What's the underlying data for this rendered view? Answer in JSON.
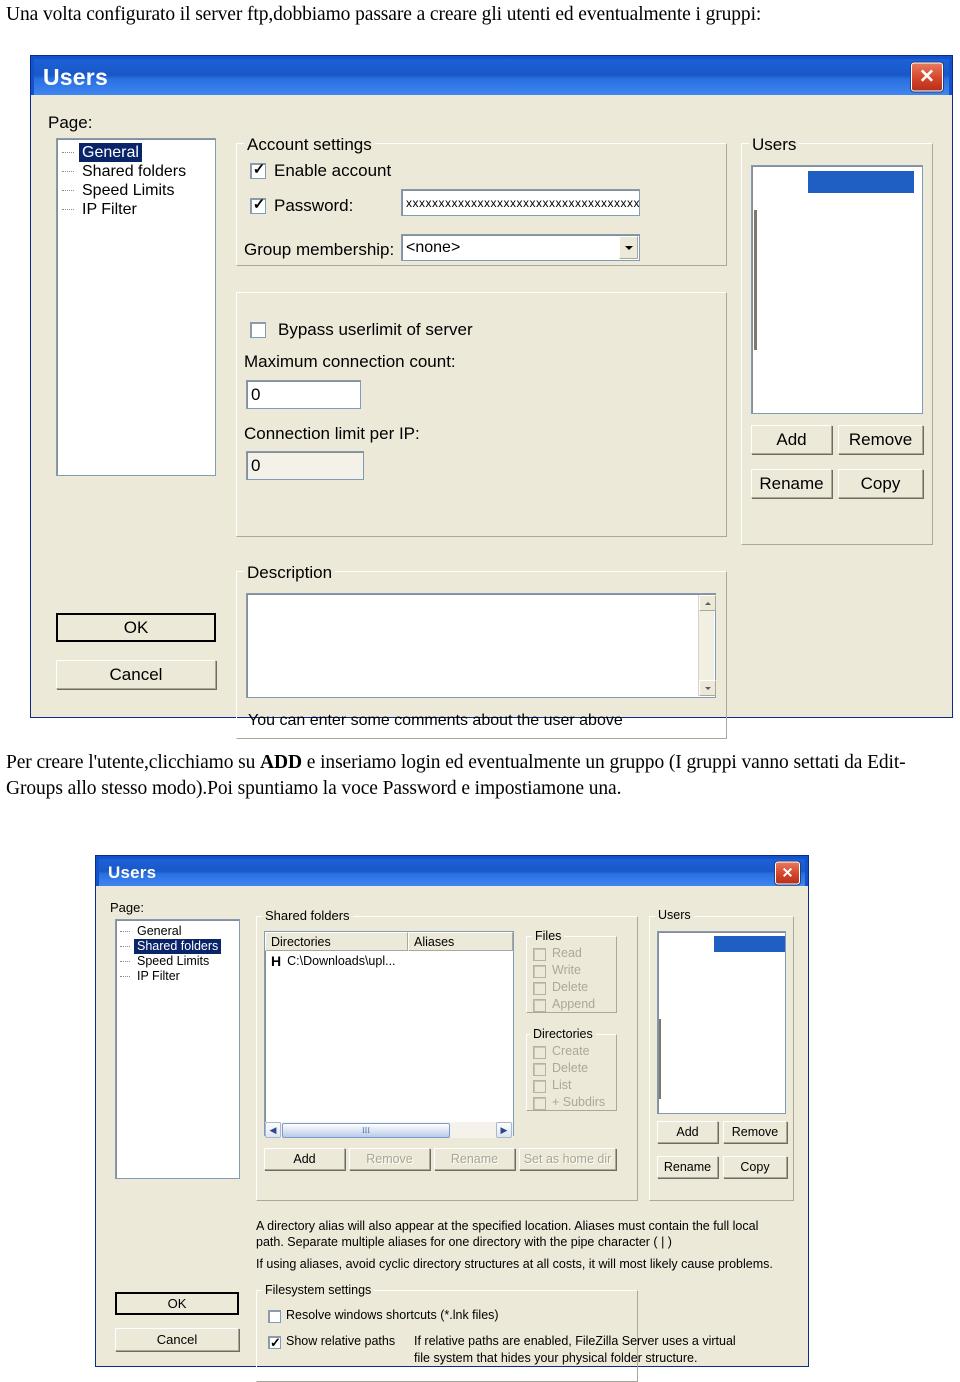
{
  "document": {
    "intro_paragraph": "Una volta configurato il server ftp,dobbiamo passare a creare gli utenti ed eventualmente i gruppi:",
    "middle_paragraph_part1": "Per creare l'utente,clicchiamo su ",
    "middle_paragraph_bold": "ADD",
    "middle_paragraph_part2": " e inseriamo login ed eventualmente un gruppo (I gruppi vanno settati da Edit-Groups  allo stesso modo).Poi spuntiamo la voce Password e impostiamone una."
  },
  "colors": {
    "titlebar_blue": "#1a58c8",
    "dialog_face": "#ece9d8",
    "selection_blue": "#0a246a",
    "list_selection": "#1f5fc4",
    "close_red": "#d5452a",
    "disabled_text": "#a9a48f"
  },
  "dialog1": {
    "title": "Users",
    "close_label": "✕",
    "page_label": "Page:",
    "tree": {
      "items": [
        {
          "label": "General",
          "selected": true
        },
        {
          "label": "Shared folders",
          "selected": false
        },
        {
          "label": "Speed Limits",
          "selected": false
        },
        {
          "label": "IP Filter",
          "selected": false
        }
      ]
    },
    "account_settings": {
      "group_title": "Account settings",
      "enable_account": {
        "label": "Enable account",
        "checked": true
      },
      "password": {
        "label": "Password:",
        "checked": true,
        "value": "xxxxxxxxxxxxxxxxxxxxxxxxxxxxxxxxxxxx"
      },
      "group_membership": {
        "label": "Group membership:",
        "value": "<none>"
      }
    },
    "limits": {
      "bypass_userlimit": {
        "label": "Bypass userlimit of server",
        "checked": false
      },
      "max_connection_count": {
        "label": "Maximum connection count:",
        "value": "0"
      },
      "connection_limit_per_ip": {
        "label": "Connection limit per IP:",
        "value": "0"
      }
    },
    "description": {
      "group_title": "Description",
      "value": "",
      "hint": "You can enter some comments about the user above"
    },
    "users_panel": {
      "group_title": "Users",
      "buttons": [
        "Add",
        "Remove",
        "Rename",
        "Copy"
      ]
    },
    "ok_label": "OK",
    "cancel_label": "Cancel"
  },
  "dialog2": {
    "title": "Users",
    "close_label": "✕",
    "page_label": "Page:",
    "tree": {
      "items": [
        {
          "label": "General",
          "selected": false
        },
        {
          "label": "Shared folders",
          "selected": true
        },
        {
          "label": "Speed Limits",
          "selected": false
        },
        {
          "label": "IP Filter",
          "selected": false
        }
      ]
    },
    "shared_folders": {
      "group_title": "Shared folders",
      "columns": [
        "Directories",
        "Aliases"
      ],
      "rows": [
        {
          "flag": "H",
          "directory": "C:\\Downloads\\upl...",
          "alias": ""
        }
      ],
      "buttons": [
        {
          "label": "Add",
          "disabled": false
        },
        {
          "label": "Remove",
          "disabled": true
        },
        {
          "label": "Rename",
          "disabled": true
        },
        {
          "label": "Set as home dir",
          "disabled": true
        }
      ],
      "hscroll": {
        "left_arrow": "◀",
        "right_arrow": "▶",
        "grip": "III"
      }
    },
    "files_group": {
      "group_title": "Files",
      "checkboxes": [
        {
          "label": "Read",
          "checked": false,
          "disabled": true
        },
        {
          "label": "Write",
          "checked": false,
          "disabled": true
        },
        {
          "label": "Delete",
          "checked": false,
          "disabled": true
        },
        {
          "label": "Append",
          "checked": false,
          "disabled": true
        }
      ]
    },
    "directories_group": {
      "group_title": "Directories",
      "checkboxes": [
        {
          "label": "Create",
          "checked": false,
          "disabled": true
        },
        {
          "label": "Delete",
          "checked": false,
          "disabled": true
        },
        {
          "label": "List",
          "checked": false,
          "disabled": true
        },
        {
          "label": "+ Subdirs",
          "checked": false,
          "disabled": true
        }
      ],
      "set_home_label": "Set as home dir"
    },
    "alias_help": [
      "A directory alias will also appear at the specified location. Aliases must contain the full local",
      "path. Separate multiple aliases for one directory with the pipe character ( | )",
      "If using aliases, avoid cyclic directory structures at all costs, it will most likely cause problems."
    ],
    "filesystem_settings": {
      "group_title": "Filesystem settings",
      "resolve_shortcuts": {
        "label": "Resolve windows shortcuts (*.lnk files)",
        "checked": false
      },
      "show_relative_paths": {
        "label": "Show relative paths",
        "checked": true
      },
      "relative_help": [
        "If relative paths are enabled, FileZilla Server uses a virtual",
        "file system that hides your physical folder structure."
      ]
    },
    "users_panel": {
      "group_title": "Users",
      "buttons": [
        "Add",
        "Remove",
        "Rename",
        "Copy"
      ]
    },
    "ok_label": "OK",
    "cancel_label": "Cancel"
  }
}
